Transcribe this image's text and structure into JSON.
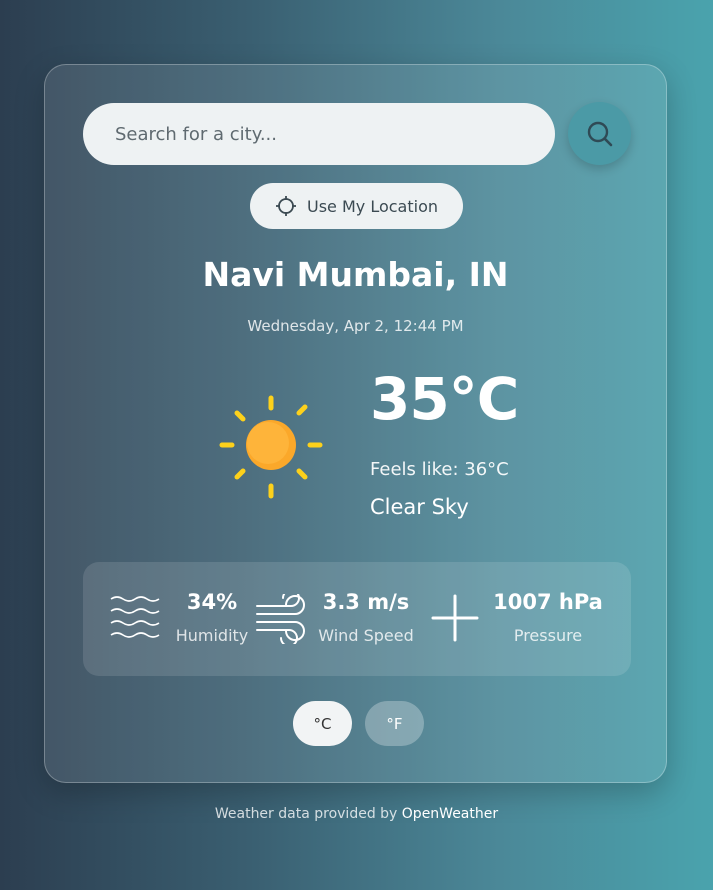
{
  "search": {
    "placeholder": "Search for a city...",
    "button_icon": "search-icon"
  },
  "location_button": {
    "label": "Use My Location",
    "icon": "crosshair-icon"
  },
  "weather": {
    "city": "Navi Mumbai, IN",
    "datetime": "Wednesday, Apr 2, 12:44 PM",
    "icon": "sun-icon",
    "temperature": "35°C",
    "feels_like": "Feels like: 36°C",
    "description": "Clear Sky"
  },
  "details": [
    {
      "icon": "humidity-waves-icon",
      "value": "34%",
      "label": "Humidity"
    },
    {
      "icon": "wind-icon",
      "value": "3.3 m/s",
      "label": "Wind Speed"
    },
    {
      "icon": "pressure-plus-icon",
      "value": "1007 hPa",
      "label": "Pressure"
    }
  ],
  "units": {
    "celsius": "°C",
    "fahrenheit": "°F",
    "selected": "celsius"
  },
  "footer": {
    "prefix": "Weather data provided by ",
    "link": "OpenWeather"
  },
  "colors": {
    "sun": "#fba82a",
    "sun_rays": "#fdd11b",
    "search_button": "#4b9aa6"
  }
}
